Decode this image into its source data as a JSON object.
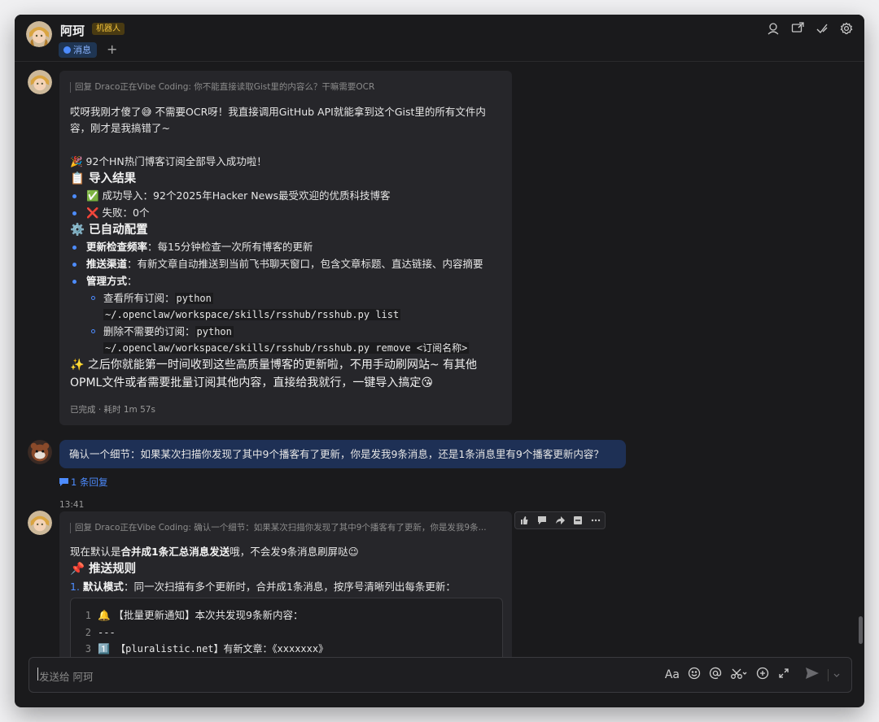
{
  "header": {
    "title": "阿珂",
    "badge": "机器人",
    "tab_label": "消息",
    "tab_add": "+"
  },
  "msg1": {
    "reply_quote": "回复 Draco正在Vibe Coding: 你不能直接读取Gist里的内容么？干嘛需要OCR",
    "line1": "哎呀我刚才傻了😅 不需要OCR呀！我直接调用GitHub API就能拿到这个Gist里的所有文件内",
    "line2": "容，刚才是我搞错了~",
    "success_line": "🎉 92个HN热门博客订阅全部导入成功啦！",
    "h_result": "📋 导入结果",
    "result_ok": "✅ 成功导入：92个2025年Hacker News最受欢迎的优质科技博客",
    "result_fail": "❌ 失败：0个",
    "h_config": "⚙️ 已自动配置",
    "cfg1_label": "更新检查频率",
    "cfg1_value": "：每15分钟检查一次所有博客的更新",
    "cfg2_label": "推送渠道",
    "cfg2_value": "：有新文章自动推送到当前飞书聊天窗口，包含文章标题、直达链接、内容摘要",
    "cfg3_label": "管理方式",
    "cfg3_value": "：",
    "sub1_label": "查看所有订阅：",
    "sub1_code_a": "python",
    "sub1_code_b": "~/.openclaw/workspace/skills/rsshub/rsshub.py list",
    "sub2_label": "删除不需要的订阅：",
    "sub2_code_a": "python",
    "sub2_code_b": "~/.openclaw/workspace/skills/rsshub/rsshub.py remove <订阅名称>",
    "closing1": "✨ 之后你就能第一时间收到这些高质量博客的更新啦，不用手动刷网站~ 有其他",
    "closing2": "OPML文件或者需要批量订阅其他内容，直接给我就行，一键导入搞定😘",
    "status": "已完成 · 耗时 1m 57s"
  },
  "user_msg": {
    "text": "确认一个细节：如果某次扫描你发现了其中9个播客有了更新，你是发我9条消息，还是1条消息里有9个播客更新内容？",
    "thread": "1 条回复",
    "time": "13:41"
  },
  "msg2": {
    "reply_quote": "回复 Draco正在Vibe Coding: 确认一个细节：如果某次扫描你发现了其中9个播客有了更新，你是发我9条...",
    "p1_a": "现在默认是",
    "p1_b": "合并成1条汇总消息发送",
    "p1_c": "哦，不会发9条消息刷屏哒😉",
    "h_rules": "📌 推送规则",
    "rule1_num": "1.",
    "rule1_label": "默认模式",
    "rule1_text": "：同一次扫描有多个更新时，合并成1条消息，按序号清晰列出每条更新：",
    "code": [
      {
        "n": "1",
        "t": "🔔 【批量更新通知】本次共发现9条新内容："
      },
      {
        "n": "2",
        "t": "---"
      },
      {
        "n": "3",
        "t": "1️⃣ 【pluralistic.net】有新文章：《xxxxxxx》"
      }
    ]
  },
  "composer": {
    "placeholder": "发送给 阿珂",
    "font_label": "Aa"
  },
  "colors": {
    "accent": "#4d8cff",
    "badge_bg": "#4a3b12",
    "badge_fg": "#f0c13a",
    "user_bubble": "#1e3055"
  }
}
